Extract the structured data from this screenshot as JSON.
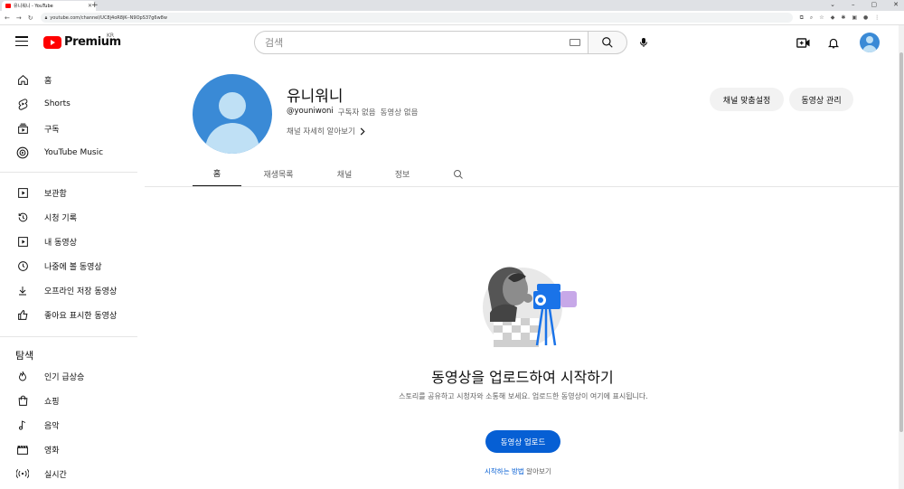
{
  "browser": {
    "tab_title": "유니워니 - YouTube",
    "tab_close": "✕",
    "new_tab": "+",
    "url": "youtube.com/channel/UC8j4oR8jK--N9OpS37g6w8w",
    "window_controls": [
      "⌄",
      "–",
      "▢",
      "✕"
    ]
  },
  "header": {
    "logo_text": "Premium",
    "logo_region": "KR",
    "search_placeholder": "검색"
  },
  "sidebar": {
    "items": [
      {
        "label": "홈",
        "icon": "home-icon"
      },
      {
        "label": "Shorts",
        "icon": "shorts-icon"
      },
      {
        "label": "구독",
        "icon": "subscriptions-icon"
      },
      {
        "label": "YouTube Music",
        "icon": "youtube-music-icon"
      }
    ],
    "library": [
      {
        "label": "보관함",
        "icon": "library-icon"
      },
      {
        "label": "시청 기록",
        "icon": "history-icon"
      },
      {
        "label": "내 동영상",
        "icon": "your-videos-icon"
      },
      {
        "label": "나중에 볼 동영상",
        "icon": "watch-later-icon"
      },
      {
        "label": "오프라인 저장 동영상",
        "icon": "download-icon"
      },
      {
        "label": "좋아요 표시한 동영상",
        "icon": "thumb-up-icon"
      }
    ],
    "explore_heading": "탐색",
    "explore": [
      {
        "label": "인기 급상승",
        "icon": "trending-icon"
      },
      {
        "label": "쇼핑",
        "icon": "shopping-icon"
      },
      {
        "label": "음악",
        "icon": "music-icon"
      },
      {
        "label": "영화",
        "icon": "movies-icon"
      },
      {
        "label": "실시간",
        "icon": "live-icon"
      }
    ]
  },
  "channel": {
    "name": "유니워니",
    "handle": "@youniwoni",
    "subscribers": "구독자 없음",
    "videos": "동영상 없음",
    "more_link": "채널 자세히 알아보기",
    "customize_button": "채널 맞춤설정",
    "manage_button": "동영상 관리"
  },
  "tabs": [
    {
      "label": "홈",
      "active": true
    },
    {
      "label": "재생목록",
      "active": false
    },
    {
      "label": "채널",
      "active": false
    },
    {
      "label": "정보",
      "active": false
    }
  ],
  "empty_state": {
    "title": "동영상을 업로드하여 시작하기",
    "description": "스토리를 공유하고 시청자와 소통해 보세요. 업로드한 동영상이 여기에 표시됩니다.",
    "upload_button": "동영상 업로드",
    "howto_link": "시작하는 방법",
    "howto_suffix": " 알아보기"
  },
  "colors": {
    "brand_red": "#ff0000",
    "accent_blue": "#065fd4",
    "avatar_blue": "#3a8ad6"
  }
}
